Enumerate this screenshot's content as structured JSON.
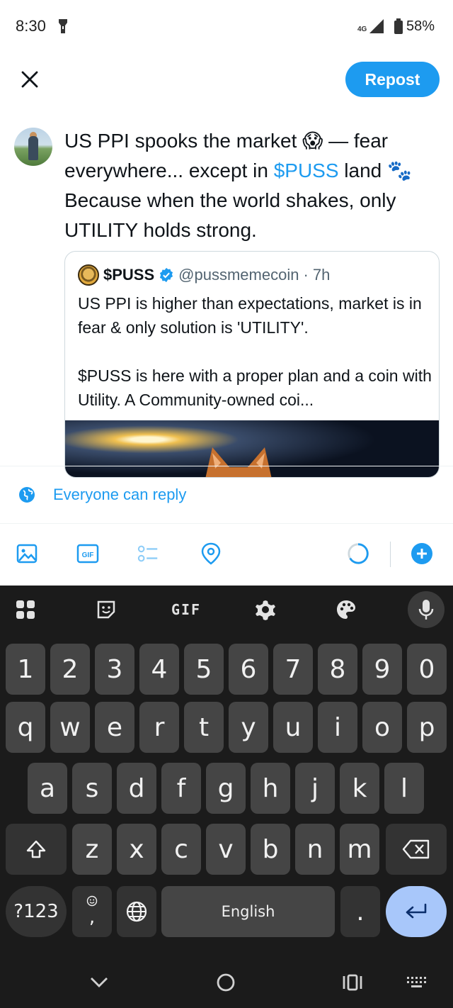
{
  "status_bar": {
    "time": "8:30",
    "network": "4G",
    "battery": "58%"
  },
  "header": {
    "repost_label": "Repost"
  },
  "composer": {
    "text_before": "US PPI spooks the market 😱 — fear everywhere... except in ",
    "cashtag": "$PUSS",
    "text_after": " land 🐾 Because when the world shakes, only UTILITY holds strong."
  },
  "quote": {
    "name": "$PUSS",
    "handle": "@pussmemecoin",
    "time": "· 7h",
    "paragraph1": "US PPI is higher than expectations, market is in fear & only solution is 'UTILITY'.",
    "paragraph2": "$PUSS is here with a proper plan and a coin with Utility. A Community-owned coi..."
  },
  "reply_settings": {
    "label": "Everyone can reply"
  },
  "keyboard": {
    "toolbar_gif": "GIF",
    "numbers": [
      "1",
      "2",
      "3",
      "4",
      "5",
      "6",
      "7",
      "8",
      "9",
      "0"
    ],
    "row1": [
      "q",
      "w",
      "e",
      "r",
      "t",
      "y",
      "u",
      "i",
      "o",
      "p"
    ],
    "row2": [
      "a",
      "s",
      "d",
      "f",
      "g",
      "h",
      "j",
      "k",
      "l"
    ],
    "row3": [
      "z",
      "x",
      "c",
      "v",
      "b",
      "n",
      "m"
    ],
    "symbols_label": "?123",
    "emoji_comma": ",",
    "space_label": "English",
    "period": "."
  },
  "colors": {
    "accent": "#1d9bf0",
    "keyboard_bg": "#1b1b1b",
    "key_bg": "#454545",
    "enter_bg": "#a8c7fa"
  }
}
